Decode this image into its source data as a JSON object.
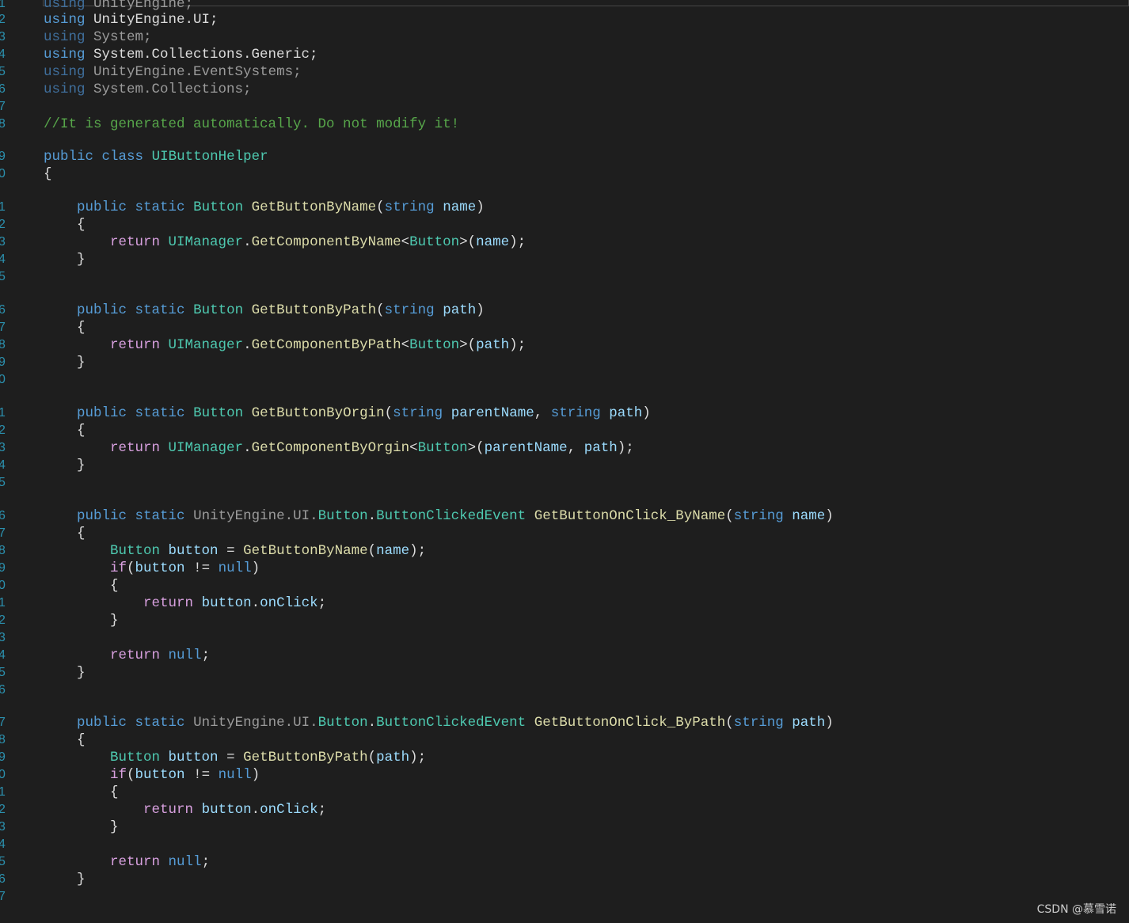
{
  "editor": {
    "lines": [
      {
        "n": "1",
        "tokens": [
          [
            "dimkw",
            "using"
          ],
          [
            "tx",
            " "
          ],
          [
            "dim",
            "UnityEngine;"
          ]
        ]
      },
      {
        "n": "2",
        "tokens": [
          [
            "kw",
            "using"
          ],
          [
            "tx",
            " UnityEngine.UI;"
          ]
        ]
      },
      {
        "n": "3",
        "tokens": [
          [
            "dimkw",
            "using"
          ],
          [
            "tx",
            " "
          ],
          [
            "dim",
            "System;"
          ]
        ]
      },
      {
        "n": "4",
        "tokens": [
          [
            "kw",
            "using"
          ],
          [
            "tx",
            " System.Collections.Generic;"
          ]
        ]
      },
      {
        "n": "5",
        "tokens": [
          [
            "dimkw",
            "using"
          ],
          [
            "tx",
            " "
          ],
          [
            "dim",
            "UnityEngine.EventSystems;"
          ]
        ]
      },
      {
        "n": "6",
        "tokens": [
          [
            "dimkw",
            "using"
          ],
          [
            "tx",
            " "
          ],
          [
            "dim",
            "System.Collections;"
          ]
        ]
      },
      {
        "n": "7",
        "tokens": []
      },
      {
        "n": "8",
        "tokens": [
          [
            "cm",
            "//It is generated automatically. Do not modify it!"
          ]
        ]
      },
      {
        "n": "9",
        "tokens": [
          [
            "kw",
            "public"
          ],
          [
            "tx",
            " "
          ],
          [
            "kw",
            "class"
          ],
          [
            "tx",
            " "
          ],
          [
            "type",
            "UIButtonHelper"
          ]
        ]
      },
      {
        "n": "0",
        "tokens": [
          [
            "pn",
            "{"
          ]
        ]
      },
      {
        "n": "1",
        "tokens": [
          [
            "tx",
            "    "
          ],
          [
            "kw",
            "public"
          ],
          [
            "tx",
            " "
          ],
          [
            "kw",
            "static"
          ],
          [
            "tx",
            " "
          ],
          [
            "type",
            "Button"
          ],
          [
            "tx",
            " "
          ],
          [
            "fn",
            "GetButtonByName"
          ],
          [
            "pn",
            "("
          ],
          [
            "kw",
            "string"
          ],
          [
            "tx",
            " "
          ],
          [
            "param",
            "name"
          ],
          [
            "pn",
            ")"
          ]
        ]
      },
      {
        "n": "2",
        "tokens": [
          [
            "tx",
            "    "
          ],
          [
            "pn",
            "{"
          ]
        ]
      },
      {
        "n": "3",
        "tokens": [
          [
            "tx",
            "        "
          ],
          [
            "kwc",
            "return"
          ],
          [
            "tx",
            " "
          ],
          [
            "type",
            "UIManager"
          ],
          [
            "pn",
            "."
          ],
          [
            "fn",
            "GetComponentByName"
          ],
          [
            "pn",
            "<"
          ],
          [
            "type",
            "Button"
          ],
          [
            "pn",
            ">("
          ],
          [
            "param",
            "name"
          ],
          [
            "pn",
            ");"
          ]
        ]
      },
      {
        "n": "4",
        "tokens": [
          [
            "tx",
            "    "
          ],
          [
            "pn",
            "}"
          ]
        ]
      },
      {
        "n": "5",
        "tokens": []
      },
      {
        "n": "6",
        "tokens": [
          [
            "tx",
            "    "
          ],
          [
            "kw",
            "public"
          ],
          [
            "tx",
            " "
          ],
          [
            "kw",
            "static"
          ],
          [
            "tx",
            " "
          ],
          [
            "type",
            "Button"
          ],
          [
            "tx",
            " "
          ],
          [
            "fn",
            "GetButtonByPath"
          ],
          [
            "pn",
            "("
          ],
          [
            "kw",
            "string"
          ],
          [
            "tx",
            " "
          ],
          [
            "param",
            "path"
          ],
          [
            "pn",
            ")"
          ]
        ]
      },
      {
        "n": "7",
        "tokens": [
          [
            "tx",
            "    "
          ],
          [
            "pn",
            "{"
          ]
        ]
      },
      {
        "n": "8",
        "tokens": [
          [
            "tx",
            "        "
          ],
          [
            "kwc",
            "return"
          ],
          [
            "tx",
            " "
          ],
          [
            "type",
            "UIManager"
          ],
          [
            "pn",
            "."
          ],
          [
            "fn",
            "GetComponentByPath"
          ],
          [
            "pn",
            "<"
          ],
          [
            "type",
            "Button"
          ],
          [
            "pn",
            ">("
          ],
          [
            "param",
            "path"
          ],
          [
            "pn",
            ");"
          ]
        ]
      },
      {
        "n": "9",
        "tokens": [
          [
            "tx",
            "    "
          ],
          [
            "pn",
            "}"
          ]
        ]
      },
      {
        "n": "0",
        "tokens": []
      },
      {
        "n": "1",
        "tokens": [
          [
            "tx",
            "    "
          ],
          [
            "kw",
            "public"
          ],
          [
            "tx",
            " "
          ],
          [
            "kw",
            "static"
          ],
          [
            "tx",
            " "
          ],
          [
            "type",
            "Button"
          ],
          [
            "tx",
            " "
          ],
          [
            "fn",
            "GetButtonByOrgin"
          ],
          [
            "pn",
            "("
          ],
          [
            "kw",
            "string"
          ],
          [
            "tx",
            " "
          ],
          [
            "param",
            "parentName"
          ],
          [
            "pn",
            ", "
          ],
          [
            "kw",
            "string"
          ],
          [
            "tx",
            " "
          ],
          [
            "param",
            "path"
          ],
          [
            "pn",
            ")"
          ]
        ]
      },
      {
        "n": "2",
        "tokens": [
          [
            "tx",
            "    "
          ],
          [
            "pn",
            "{"
          ]
        ]
      },
      {
        "n": "3",
        "tokens": [
          [
            "tx",
            "        "
          ],
          [
            "kwc",
            "return"
          ],
          [
            "tx",
            " "
          ],
          [
            "type",
            "UIManager"
          ],
          [
            "pn",
            "."
          ],
          [
            "fn",
            "GetComponentByOrgin"
          ],
          [
            "pn",
            "<"
          ],
          [
            "type",
            "Button"
          ],
          [
            "pn",
            ">("
          ],
          [
            "param",
            "parentName"
          ],
          [
            "pn",
            ", "
          ],
          [
            "param",
            "path"
          ],
          [
            "pn",
            ");"
          ]
        ]
      },
      {
        "n": "4",
        "tokens": [
          [
            "tx",
            "    "
          ],
          [
            "pn",
            "}"
          ]
        ]
      },
      {
        "n": "5",
        "tokens": []
      },
      {
        "n": "6",
        "tokens": [
          [
            "tx",
            "    "
          ],
          [
            "kw",
            "public"
          ],
          [
            "tx",
            " "
          ],
          [
            "kw",
            "static"
          ],
          [
            "tx",
            " "
          ],
          [
            "dim",
            "UnityEngine.UI."
          ],
          [
            "type",
            "Button"
          ],
          [
            "pn",
            "."
          ],
          [
            "type",
            "ButtonClickedEvent"
          ],
          [
            "tx",
            " "
          ],
          [
            "fn",
            "GetButtonOnClick_ByName"
          ],
          [
            "pn",
            "("
          ],
          [
            "kw",
            "string"
          ],
          [
            "tx",
            " "
          ],
          [
            "param",
            "name"
          ],
          [
            "pn",
            ")"
          ]
        ]
      },
      {
        "n": "7",
        "tokens": [
          [
            "tx",
            "    "
          ],
          [
            "pn",
            "{"
          ]
        ]
      },
      {
        "n": "8",
        "tokens": [
          [
            "tx",
            "        "
          ],
          [
            "type",
            "Button"
          ],
          [
            "tx",
            " "
          ],
          [
            "local",
            "button"
          ],
          [
            "tx",
            " = "
          ],
          [
            "fn",
            "GetButtonByName"
          ],
          [
            "pn",
            "("
          ],
          [
            "param",
            "name"
          ],
          [
            "pn",
            ");"
          ]
        ]
      },
      {
        "n": "9",
        "tokens": [
          [
            "tx",
            "        "
          ],
          [
            "kwc",
            "if"
          ],
          [
            "pn",
            "("
          ],
          [
            "local",
            "button"
          ],
          [
            "tx",
            " != "
          ],
          [
            "kw",
            "null"
          ],
          [
            "pn",
            ")"
          ]
        ]
      },
      {
        "n": "0",
        "tokens": [
          [
            "tx",
            "        "
          ],
          [
            "pn",
            "{"
          ]
        ]
      },
      {
        "n": "1",
        "tokens": [
          [
            "tx",
            "            "
          ],
          [
            "kwc",
            "return"
          ],
          [
            "tx",
            " "
          ],
          [
            "local",
            "button"
          ],
          [
            "pn",
            "."
          ],
          [
            "param",
            "onClick"
          ],
          [
            "pn",
            ";"
          ]
        ]
      },
      {
        "n": "2",
        "tokens": [
          [
            "tx",
            "        "
          ],
          [
            "pn",
            "}"
          ]
        ]
      },
      {
        "n": "3",
        "tokens": []
      },
      {
        "n": "4",
        "tokens": [
          [
            "tx",
            "        "
          ],
          [
            "kwc",
            "return"
          ],
          [
            "tx",
            " "
          ],
          [
            "kw",
            "null"
          ],
          [
            "pn",
            ";"
          ]
        ]
      },
      {
        "n": "5",
        "tokens": [
          [
            "tx",
            "    "
          ],
          [
            "pn",
            "}"
          ]
        ]
      },
      {
        "n": "6",
        "tokens": []
      },
      {
        "n": "7",
        "tokens": [
          [
            "tx",
            "    "
          ],
          [
            "kw",
            "public"
          ],
          [
            "tx",
            " "
          ],
          [
            "kw",
            "static"
          ],
          [
            "tx",
            " "
          ],
          [
            "dim",
            "UnityEngine.UI."
          ],
          [
            "type",
            "Button"
          ],
          [
            "pn",
            "."
          ],
          [
            "type",
            "ButtonClickedEvent"
          ],
          [
            "tx",
            " "
          ],
          [
            "fn",
            "GetButtonOnClick_ByPath"
          ],
          [
            "pn",
            "("
          ],
          [
            "kw",
            "string"
          ],
          [
            "tx",
            " "
          ],
          [
            "param",
            "path"
          ],
          [
            "pn",
            ")"
          ]
        ]
      },
      {
        "n": "8",
        "tokens": [
          [
            "tx",
            "    "
          ],
          [
            "pn",
            "{"
          ]
        ]
      },
      {
        "n": "9",
        "tokens": [
          [
            "tx",
            "        "
          ],
          [
            "type",
            "Button"
          ],
          [
            "tx",
            " "
          ],
          [
            "local",
            "button"
          ],
          [
            "tx",
            " = "
          ],
          [
            "fn",
            "GetButtonByPath"
          ],
          [
            "pn",
            "("
          ],
          [
            "param",
            "path"
          ],
          [
            "pn",
            ");"
          ]
        ]
      },
      {
        "n": "0",
        "tokens": [
          [
            "tx",
            "        "
          ],
          [
            "kwc",
            "if"
          ],
          [
            "pn",
            "("
          ],
          [
            "local",
            "button"
          ],
          [
            "tx",
            " != "
          ],
          [
            "kw",
            "null"
          ],
          [
            "pn",
            ")"
          ]
        ]
      },
      {
        "n": "1",
        "tokens": [
          [
            "tx",
            "        "
          ],
          [
            "pn",
            "{"
          ]
        ]
      },
      {
        "n": "2",
        "tokens": [
          [
            "tx",
            "            "
          ],
          [
            "kwc",
            "return"
          ],
          [
            "tx",
            " "
          ],
          [
            "local",
            "button"
          ],
          [
            "pn",
            "."
          ],
          [
            "param",
            "onClick"
          ],
          [
            "pn",
            ";"
          ]
        ]
      },
      {
        "n": "3",
        "tokens": [
          [
            "tx",
            "        "
          ],
          [
            "pn",
            "}"
          ]
        ]
      },
      {
        "n": "4",
        "tokens": []
      },
      {
        "n": "5",
        "tokens": [
          [
            "tx",
            "        "
          ],
          [
            "kwc",
            "return"
          ],
          [
            "tx",
            " "
          ],
          [
            "kw",
            "null"
          ],
          [
            "pn",
            ";"
          ]
        ]
      },
      {
        "n": "6",
        "tokens": [
          [
            "tx",
            "    "
          ],
          [
            "pn",
            "}"
          ]
        ]
      },
      {
        "n": "7",
        "tokens": []
      }
    ]
  },
  "watermark": "CSDN @慕雪诺",
  "colors": {
    "background": "#1e1e1e",
    "line_number": "#2b91af",
    "keyword": "#569cd6",
    "control_keyword": "#d8a0df",
    "type": "#4ec9b0",
    "method": "#dcdcaa",
    "parameter": "#9cdcfe",
    "comment": "#57a64a",
    "text": "#dcdcdc"
  },
  "icons": {
    "lightbulb": "lightbulb-icon"
  }
}
